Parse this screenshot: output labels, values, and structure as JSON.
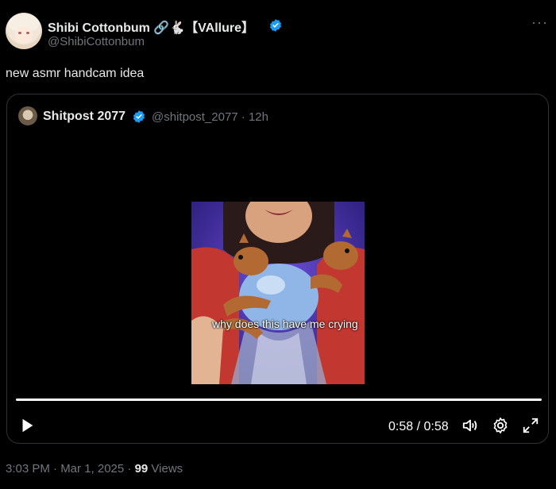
{
  "author": {
    "display_name": "Shibi Cottonbum 🔗🐇【VAllure】",
    "handle": "@ShibiCottonbum"
  },
  "tweet": {
    "text": "new asmr handcam idea",
    "timestamp": "3:03 PM · Mar 1, 2025 · ",
    "views_count": "99",
    "views_label": " Views"
  },
  "quoted": {
    "display_name": "Shitpost 2077",
    "meta": "@shitpost_2077 · 12h",
    "video": {
      "caption": "why does this have me crying",
      "time": "0:58 / 0:58",
      "progress": 1.0
    }
  },
  "icons": {
    "verified": "verified-badge-icon",
    "more": "more-horizontal-icon",
    "play": "play-icon",
    "volume": "volume-icon",
    "settings": "gear-icon",
    "fullscreen": "fullscreen-icon"
  },
  "colors": {
    "verified": "#1d9bf0",
    "muted_text": "#71767b",
    "border": "#2f3336"
  }
}
